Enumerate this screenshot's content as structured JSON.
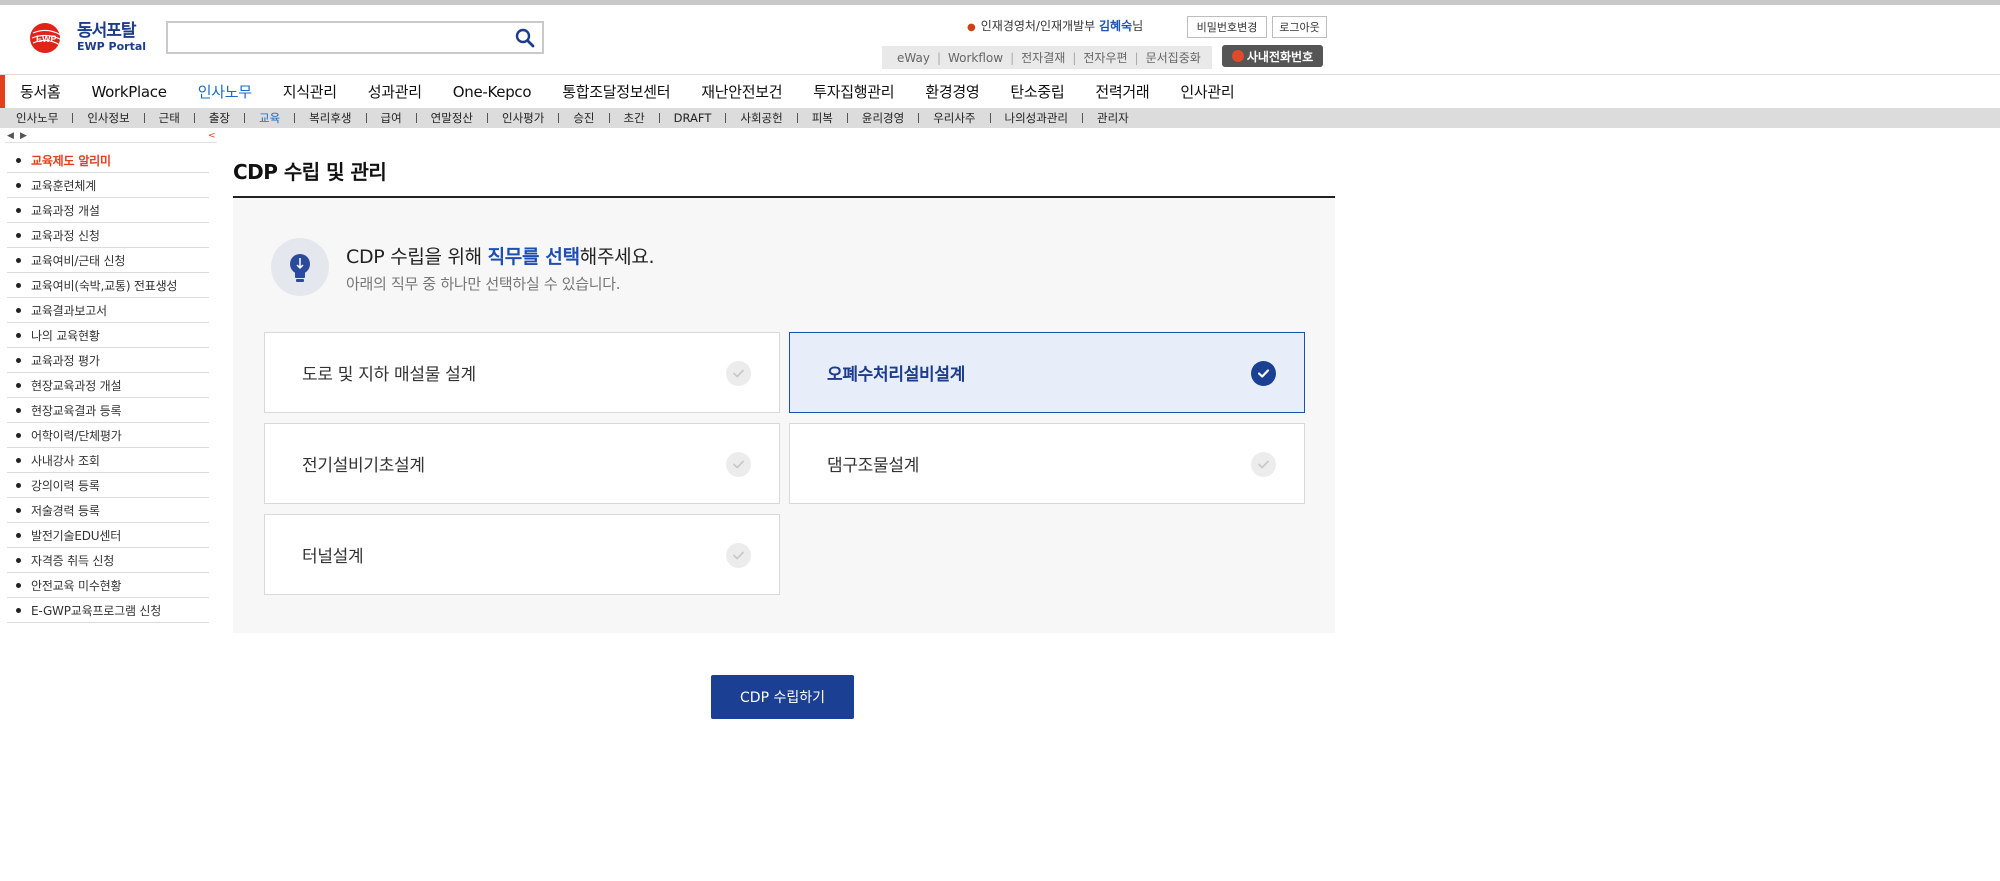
{
  "header": {
    "logo_ko": "동서포탈",
    "logo_en": "EWP Portal",
    "logo_mark_text": "EWP",
    "search_value": "",
    "user_org": "인재경영처/인재개발부",
    "user_name": "김혜숙",
    "user_suffix": "님",
    "password_button": "비밀번호변경",
    "logout_button": "로그아웃",
    "quick_links": [
      "eWay",
      "Workflow",
      "전자결재",
      "전자우편",
      "문서집중화"
    ],
    "phone_button": "사내전화번호"
  },
  "main_nav": [
    "동서홈",
    "WorkPlace",
    "인사노무",
    "지식관리",
    "성과관리",
    "One-Kepco",
    "통합조달정보센터",
    "재난안전보건",
    "투자집행관리",
    "환경경영",
    "탄소중립",
    "전력거래",
    "인사관리"
  ],
  "main_nav_active": "인사노무",
  "sub_nav": [
    "인사노무",
    "인사정보",
    "근태",
    "출장",
    "교육",
    "복리후생",
    "급여",
    "연말정산",
    "인사평가",
    "승진",
    "초간",
    "DRAFT",
    "사회공헌",
    "피복",
    "윤리경영",
    "우리사주",
    "나의성과관리",
    "관리자"
  ],
  "sub_nav_active": "교육",
  "sidebar": {
    "items": [
      "교육제도 알리미",
      "교육훈련체계",
      "교육과정 개설",
      "교육과정 신청",
      "교육여비/근태 신청",
      "교육여비(숙박,교통) 전표생성",
      "교육결과보고서",
      "나의 교육현황",
      "교육과정 평가",
      "현장교육과정 개설",
      "현장교육결과 등록",
      "어학이력/단체평가",
      "사내강사 조회",
      "강의이력 등록",
      "저술경력 등록",
      "발전기술EDU센터",
      "자격증 취득 신청",
      "안전교육 미수현황",
      "E-GWP교육프로그램 신청"
    ],
    "active": "교육제도 알리미"
  },
  "page": {
    "title": "CDP 수립 및 관리",
    "guide_prefix": "CDP 수립을 위해 ",
    "guide_highlight": "직무를 선택",
    "guide_suffix": "해주세요.",
    "guide_sub": "아래의 직무 중 하나만 선택하실 수 있습니다.",
    "jobs": [
      {
        "label": "도로 및 지하 매설물 설계",
        "selected": false
      },
      {
        "label": "오폐수처리설비설계",
        "selected": true
      },
      {
        "label": "전기설비기초설계",
        "selected": false
      },
      {
        "label": "댐구조물설계",
        "selected": false
      },
      {
        "label": "터널설계",
        "selected": false
      }
    ],
    "submit_button": "CDP 수립하기"
  },
  "colors": {
    "accent_red": "#e2401a",
    "primary_blue": "#1a3f93",
    "link_blue": "#1d6bc4",
    "selected_bg": "#e8eef9"
  }
}
